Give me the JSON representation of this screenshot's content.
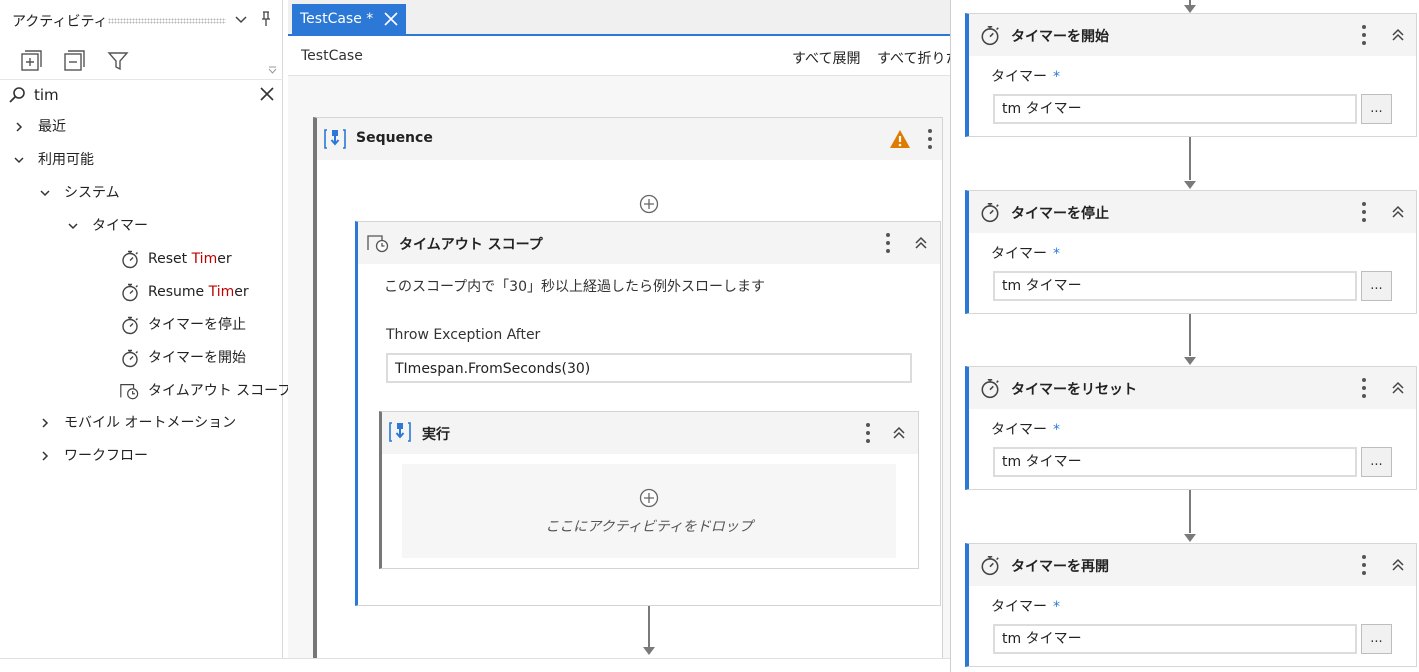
{
  "activities_panel": {
    "title": "アクティビティ",
    "search": {
      "value": "tim"
    },
    "tree": {
      "recent": "最近",
      "available": "利用可能",
      "system": "システム",
      "timer": "タイマー",
      "leaves": [
        {
          "prefix": "Reset ",
          "match": "Tim",
          "suffix": "er"
        },
        {
          "prefix": "Resume ",
          "match": "Tim",
          "suffix": "er"
        },
        {
          "prefix": "タイマーを停止",
          "match": "",
          "suffix": ""
        },
        {
          "prefix": "タイマーを開始",
          "match": "",
          "suffix": ""
        },
        {
          "prefix": "タイムアウト スコープ",
          "match": "",
          "suffix": ""
        }
      ],
      "mobile": "モバイル オートメーション",
      "workflow": "ワークフロー"
    }
  },
  "designer": {
    "tab_label": "TestCase *",
    "breadcrumb": "TestCase",
    "expand_all": "すべて展開",
    "collapse_all": "すべて折りた",
    "sequence_title": "Sequence",
    "timeout_scope": {
      "title": "タイムアウト スコープ",
      "description": "このスコープ内で「30」秒以上経過したら例外スローします",
      "field_label": "Throw Exception After",
      "field_value": "TImespan.FromSeconds(30)"
    },
    "execute": {
      "title": "実行",
      "drop_hint": "ここにアクティビティをドロップ"
    }
  },
  "right_panel": {
    "cards": [
      {
        "title": "タイマーを開始",
        "field_label": "タイマー",
        "required": "*",
        "value": "tm  タイマー",
        "button": "..."
      },
      {
        "title": "タイマーを停止",
        "field_label": "タイマー",
        "required": "*",
        "value": "tm  タイマー",
        "button": "..."
      },
      {
        "title": "タイマーをリセット",
        "field_label": "タイマー",
        "required": "*",
        "value": "tm  タイマー",
        "button": "..."
      },
      {
        "title": "タイマーを再開",
        "field_label": "タイマー",
        "required": "*",
        "value": "tm  タイマー",
        "button": "..."
      }
    ]
  },
  "colors": {
    "accent": "#2b78d6",
    "warning": "#e07b00",
    "match_highlight": "#c00000"
  }
}
